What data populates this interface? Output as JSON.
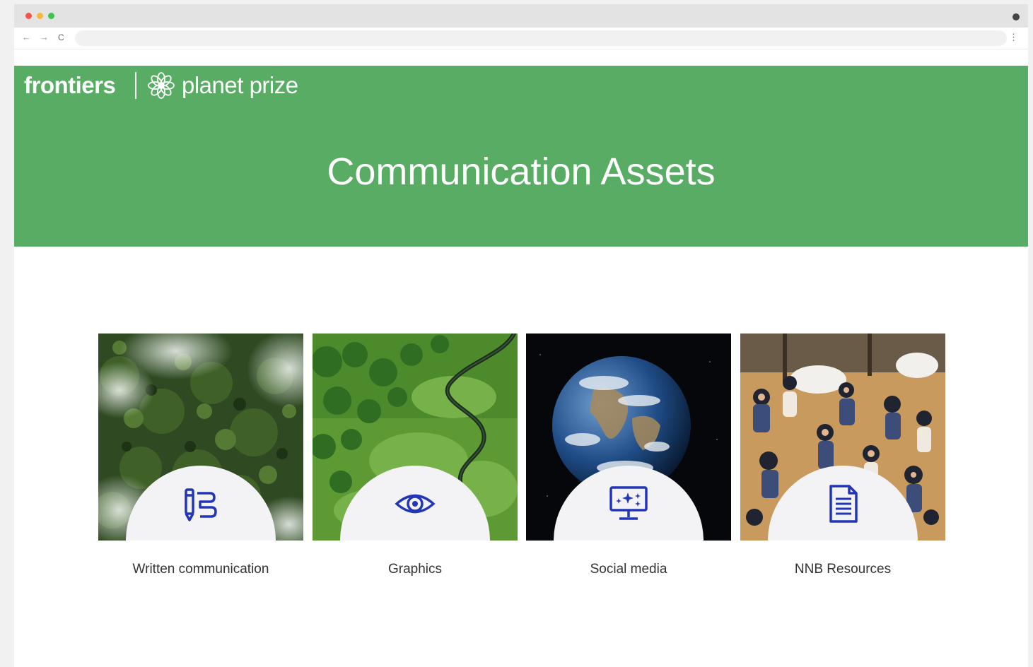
{
  "browser": {
    "back_icon": "←",
    "forward_icon": "→",
    "reload_icon": "C",
    "menu_icon": "⋮"
  },
  "header": {
    "brand_frontiers": "frontiers",
    "brand_product": "planet prize",
    "hero_title": "Communication Assets",
    "hero_color": "#58ac63"
  },
  "cards": [
    {
      "label": "Written communication",
      "icon": "pencil-list-icon",
      "image": "forest-canopy-clouds-image"
    },
    {
      "label": "Graphics",
      "icon": "eye-icon",
      "image": "river-wetland-aerial-image"
    },
    {
      "label": "Social media",
      "icon": "monitor-icon",
      "image": "earth-from-space-image"
    },
    {
      "label": "NNB Resources",
      "icon": "document-icon",
      "image": "conference-crowd-image"
    }
  ],
  "colors": {
    "icon_color": "#2336b8",
    "circle_bg": "#f3f2f4"
  }
}
